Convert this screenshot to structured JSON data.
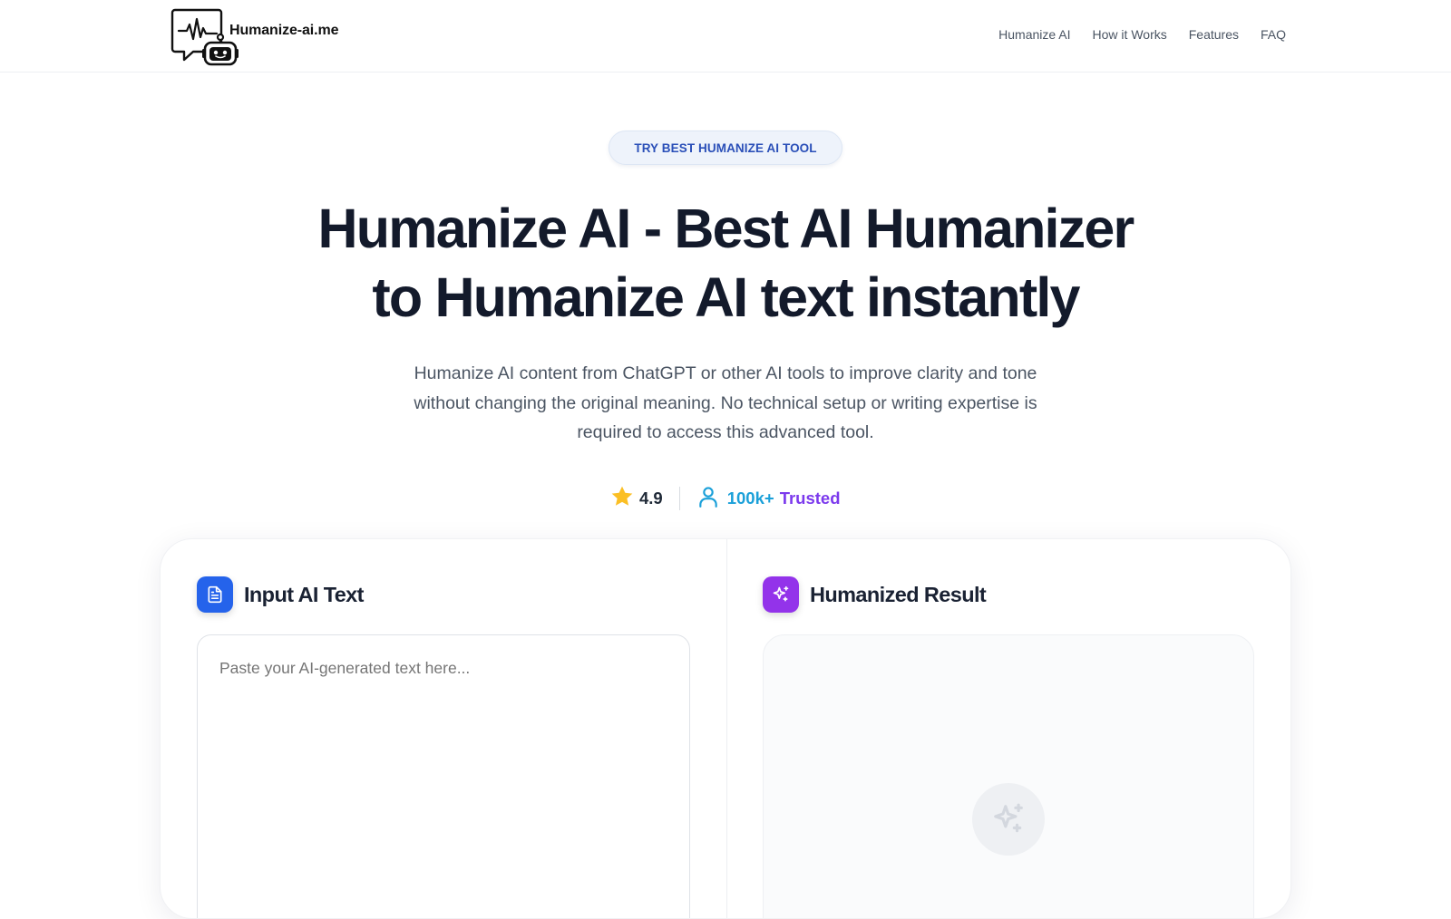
{
  "header": {
    "logo_text": "Humanize-ai.me",
    "nav": [
      "Humanize AI",
      "How it Works",
      "Features",
      "FAQ"
    ]
  },
  "hero": {
    "badge": "TRY BEST HUMANIZE AI TOOL",
    "title_line1": "Humanize AI - Best AI Humanizer",
    "title_line2": "to Humanize AI text instantly",
    "subtitle": "Humanize AI content from ChatGPT or other AI tools to improve clarity and tone without changing the original meaning. No technical setup or writing expertise is required to access this advanced tool."
  },
  "stats": {
    "rating": "4.9",
    "trusted_count": "100k+",
    "trusted_word": "Trusted"
  },
  "tool": {
    "input_title": "Input AI Text",
    "input_placeholder": "Paste your AI-generated text here...",
    "input_value": "",
    "result_title": "Humanized Result"
  },
  "icons": {
    "star": "star-icon",
    "user": "user-icon",
    "document": "document-icon",
    "sparkles": "sparkles-icon"
  },
  "colors": {
    "brand_blue": "#2563eb",
    "brand_purple": "#9333ea",
    "star": "#fbbf24",
    "trusted_count": "#1ba0d9",
    "trusted_word": "#7c3aed",
    "badge_text": "#2a4fb8"
  }
}
